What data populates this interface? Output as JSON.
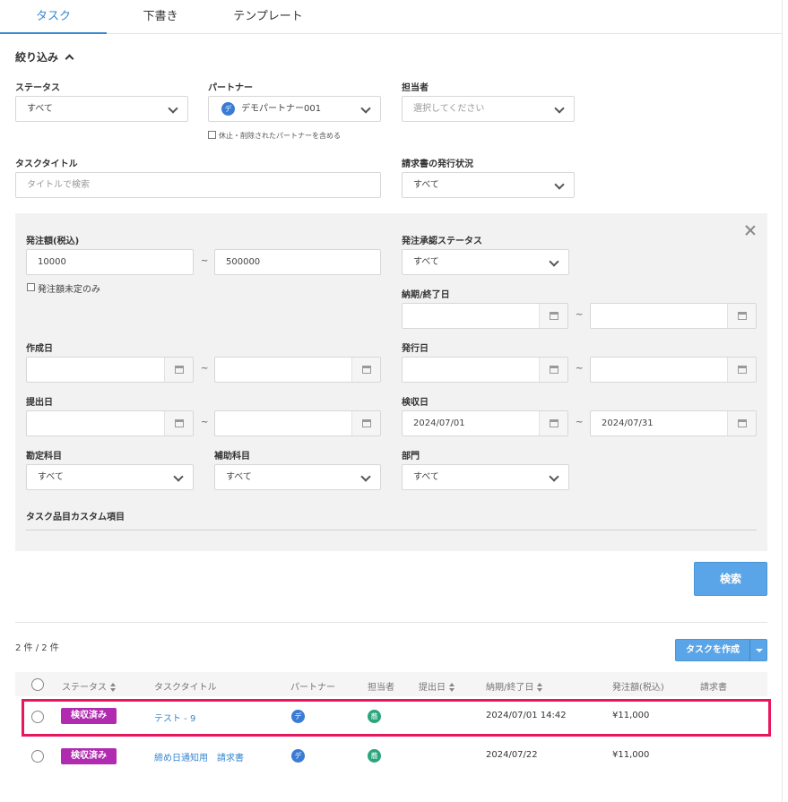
{
  "tabs": [
    {
      "label": "タスク"
    },
    {
      "label": "下書き"
    },
    {
      "label": "テンプレート"
    }
  ],
  "filter": {
    "toggle_label": "絞り込み",
    "status": {
      "label": "ステータス",
      "value": "すべて"
    },
    "partner": {
      "label": "パートナー",
      "avatar": "デ",
      "value": "デモパートナー001",
      "include_label": "休止・削除されたパートナーを含める"
    },
    "assignee": {
      "label": "担当者",
      "placeholder": "選択してください"
    },
    "task_title": {
      "label": "タスクタイトル",
      "placeholder": "タイトルで検索"
    },
    "invoice_status": {
      "label": "請求書の発行状況",
      "value": "すべて"
    },
    "tilde": "~",
    "order_amount": {
      "label": "発注額(税込)",
      "min": "10000",
      "max": "500000",
      "undecided_label": "発注額未定のみ"
    },
    "approval_status": {
      "label": "発注承認ステータス",
      "value": "すべて"
    },
    "due_date": {
      "label": "納期/終了日"
    },
    "created_date": {
      "label": "作成日"
    },
    "issued_date": {
      "label": "発行日"
    },
    "submitted_date": {
      "label": "提出日"
    },
    "inspection_date": {
      "label": "検収日",
      "from": "2024/07/01",
      "to": "2024/07/31"
    },
    "account": {
      "label": "勘定科目",
      "value": "すべて"
    },
    "sub_account": {
      "label": "補助科目",
      "value": "すべて"
    },
    "department": {
      "label": "部門",
      "value": "すべて"
    },
    "custom_items_label": "タスク品目カスタム項目",
    "search_button": "検索"
  },
  "list": {
    "count": "2 件 / 2 件",
    "create_button": "タスクを作成",
    "columns": {
      "status": "ステータス",
      "title": "タスクタイトル",
      "partner": "パートナー",
      "assignee": "担当者",
      "submitted": "提出日",
      "due": "納期/終了日",
      "amount": "発注額(税込)",
      "invoice": "請求書"
    },
    "rows": [
      {
        "status": "検収済み",
        "title": "テスト - 9",
        "partner_avatar": "デ",
        "assignee_avatar": "蕎",
        "submitted": "",
        "due": "2024/07/01 14:42",
        "amount": "¥11,000",
        "invoice": ""
      },
      {
        "status": "検収済み",
        "title": "締め日通知用　請求書",
        "partner_avatar": "デ",
        "assignee_avatar": "蕎",
        "submitted": "",
        "due": "2024/07/22",
        "amount": "¥11,000",
        "invoice": ""
      }
    ]
  },
  "colors": {
    "accent": "#3a87cf",
    "badge": "#b02bb0",
    "highlight": "#e8175d",
    "panel": "#f2f2f2"
  }
}
